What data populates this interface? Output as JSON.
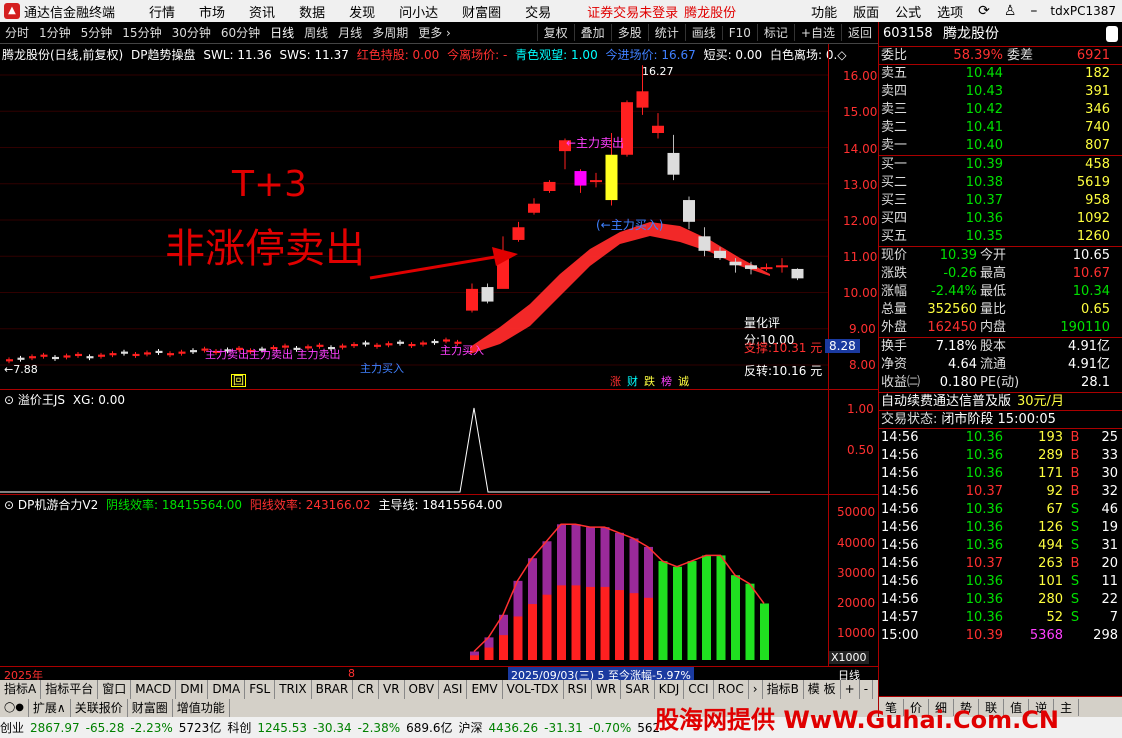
{
  "menubar": {
    "app_title": "通达信金融终端",
    "items": [
      "行情",
      "市场",
      "资讯",
      "数据",
      "发现",
      "问小达",
      "财富圈",
      "交易"
    ],
    "notice": "证券交易未登录",
    "notice_stock": "腾龙股份",
    "right_items": [
      "功能",
      "版面",
      "公式",
      "选项"
    ],
    "user": "tdxPC1387"
  },
  "periodbar": {
    "items": [
      "分时",
      "1分钟",
      "5分钟",
      "15分钟",
      "30分钟",
      "60分钟",
      "日线",
      "周线",
      "月线",
      "多周期",
      "更多 ›"
    ],
    "active": "日线",
    "tools": [
      "复权",
      "叠加",
      "多股",
      "统计",
      "画线",
      "F10",
      "标记",
      "+自选",
      "返回"
    ]
  },
  "main_chart": {
    "title": "腾龙股份(日线,前复权)",
    "indicator": "DP趋势操盘",
    "swl": "SWL: 11.36",
    "sws": "SWS: 11.37",
    "hold_label": "红色持股: 0.00",
    "leave_label": "今离场价: -",
    "watch_label": "青色观望: 1.00",
    "enter_label": "今进场价: 16.67",
    "short_label": "短买: 0.00",
    "white_label": "白色离场: 0.◇",
    "annotation_title": "T+3",
    "annotation_sub": "非涨停卖出",
    "labels": {
      "sell1": "←主力卖出",
      "buy1": "(←主力买入)",
      "high": "16.27",
      "low": "←7.88",
      "left_marks": "主力卖出主力卖出 主力卖出",
      "left_marks2": "主力买入",
      "left_marks3": "主力买入"
    },
    "quant_score": "量化评分:10.00",
    "support": "支撑:10.31 元",
    "reversal": "反转:10.16 元",
    "cur_price_tag": "8.28",
    "bottom_tags": [
      "涨",
      "财",
      "跌",
      "榜",
      "诚"
    ],
    "return_tag": "回",
    "y_ticks": [
      "16.00",
      "15.00",
      "14.00",
      "13.00",
      "12.00",
      "11.00",
      "10.00",
      "9.00",
      "8.00"
    ]
  },
  "chart_data": {
    "type": "candlestick",
    "ylim": [
      7.6,
      16.4
    ],
    "candles": [
      {
        "o": 9.5,
        "c": 10.1,
        "h": 10.25,
        "l": 9.45
      },
      {
        "o": 10.15,
        "c": 9.75,
        "h": 10.25,
        "l": 9.7
      },
      {
        "o": 10.1,
        "c": 11.1,
        "h": 11.55,
        "l": 10.7
      },
      {
        "o": 11.45,
        "c": 11.8,
        "h": 11.95,
        "l": 11.4
      },
      {
        "o": 12.2,
        "c": 12.45,
        "h": 12.6,
        "l": 12.15
      },
      {
        "o": 12.8,
        "c": 13.05,
        "h": 13.1,
        "l": 12.75
      },
      {
        "o": 13.9,
        "c": 14.2,
        "h": 14.25,
        "l": 13.4
      },
      {
        "o": 12.95,
        "c": 13.35,
        "h": 13.4,
        "l": 12.75
      },
      {
        "o": 13.1,
        "c": 13.1,
        "h": 13.3,
        "l": 12.9
      },
      {
        "o": 12.55,
        "c": 13.8,
        "h": 14.4,
        "l": 12.4
      },
      {
        "o": 13.8,
        "c": 15.25,
        "h": 15.3,
        "l": 13.75
      },
      {
        "o": 15.1,
        "c": 15.55,
        "h": 16.27,
        "l": 14.9
      },
      {
        "o": 14.4,
        "c": 14.6,
        "h": 14.95,
        "l": 14.25
      },
      {
        "o": 13.85,
        "c": 13.25,
        "h": 14.35,
        "l": 13.1
      },
      {
        "o": 12.55,
        "c": 11.95,
        "h": 12.65,
        "l": 11.75
      },
      {
        "o": 11.55,
        "c": 11.15,
        "h": 11.8,
        "l": 11.0
      },
      {
        "o": 11.15,
        "c": 10.95,
        "h": 11.25,
        "l": 10.9
      },
      {
        "o": 10.85,
        "c": 10.75,
        "h": 10.95,
        "l": 10.55
      },
      {
        "o": 10.75,
        "c": 10.65,
        "h": 10.85,
        "l": 10.5
      },
      {
        "o": 10.65,
        "c": 10.7,
        "h": 10.8,
        "l": 10.6
      },
      {
        "o": 10.75,
        "c": 10.75,
        "h": 10.95,
        "l": 10.55
      },
      {
        "o": 10.65,
        "c": 10.39,
        "h": 10.67,
        "l": 10.34
      }
    ]
  },
  "sub1": {
    "title": "溢价王JS",
    "xg": "XG: 0.00",
    "ticks": [
      "1.00",
      "0.50"
    ]
  },
  "sub2": {
    "title": "DP机游合力V2",
    "yin": "阴线效率: 18415564.00",
    "yang": "阳线效率: 243166.02",
    "main": "主导线: 18415564.00",
    "ticks": [
      "50000",
      "40000",
      "30000",
      "20000",
      "10000"
    ],
    "unit": "X1000"
  },
  "datebar": {
    "year": "2025年",
    "month": "8",
    "range": "2025/09/03(三) 5 至今涨幅-5.97%",
    "period": "日线"
  },
  "tabs": [
    "指标A",
    "指标平台",
    "窗口",
    "MACD",
    "DMI",
    "DMA",
    "FSL",
    "TRIX",
    "BRAR",
    "CR",
    "VR",
    "OBV",
    "ASI",
    "EMV",
    "VOL-TDX",
    "RSI",
    "WR",
    "SAR",
    "KDJ",
    "CCI",
    "ROC",
    "›",
    "指标B",
    "模 板",
    "+",
    "-"
  ],
  "tabs2": [
    "扩展∧",
    "关联报价",
    "财富圈",
    "增值功能"
  ],
  "status": [
    {
      "name": "创业",
      "v": "2867.97",
      "chg": "-65.28",
      "pct": "-2.23%",
      "amt": "5723亿"
    },
    {
      "name": "科创",
      "v": "1245.53",
      "chg": "-30.34",
      "pct": "-2.38%",
      "amt": "689.6亿"
    },
    {
      "name": "沪深",
      "v": "4436.26",
      "chg": "-31.31",
      "pct": "-0.70%",
      "amt": "562"
    }
  ],
  "watermark": "股海网提供 WwW.Guhai.Com.CN",
  "right": {
    "code": "603158",
    "name": "腾龙股份",
    "ratio_label": "委比",
    "ratio": "58.39%",
    "diff_label": "委差",
    "diff": "6921",
    "asks": [
      [
        "卖五",
        "10.44",
        "182"
      ],
      [
        "卖四",
        "10.43",
        "391"
      ],
      [
        "卖三",
        "10.42",
        "346"
      ],
      [
        "卖二",
        "10.41",
        "740"
      ],
      [
        "卖一",
        "10.40",
        "807"
      ]
    ],
    "bids": [
      [
        "买一",
        "10.39",
        "458"
      ],
      [
        "买二",
        "10.38",
        "5619"
      ],
      [
        "买三",
        "10.37",
        "958"
      ],
      [
        "买四",
        "10.36",
        "1092"
      ],
      [
        "买五",
        "10.35",
        "1260"
      ]
    ],
    "quote": [
      [
        "现价",
        "10.39",
        "今开",
        "10.65"
      ],
      [
        "涨跌",
        "-0.26",
        "最高",
        "10.67"
      ],
      [
        "涨幅",
        "-2.44%",
        "最低",
        "10.34"
      ],
      [
        "总量",
        "352560",
        "量比",
        "0.65"
      ],
      [
        "外盘",
        "162450",
        "内盘",
        "190110"
      ]
    ],
    "quote2": [
      [
        "换手",
        "7.18%",
        "股本",
        "4.91亿"
      ],
      [
        "净资",
        "4.64",
        "流通",
        "4.91亿"
      ],
      [
        "收益㈡",
        "0.180",
        "PE(动)",
        "28.1"
      ]
    ],
    "ad": "自动续费通达信普及版",
    "ad_price": "30元/月",
    "trade_state_label": "交易状态:",
    "trade_state": "闭市阶段 15:00:05",
    "ticks": [
      [
        "14:56",
        "10.36",
        "193",
        "B",
        "25"
      ],
      [
        "14:56",
        "10.36",
        "289",
        "B",
        "33"
      ],
      [
        "14:56",
        "10.36",
        "171",
        "B",
        "30"
      ],
      [
        "14:56",
        "10.37",
        "92",
        "B",
        "32"
      ],
      [
        "14:56",
        "10.36",
        "67",
        "S",
        "46"
      ],
      [
        "14:56",
        "10.36",
        "126",
        "S",
        "19"
      ],
      [
        "14:56",
        "10.36",
        "494",
        "S",
        "31"
      ],
      [
        "14:56",
        "10.37",
        "263",
        "B",
        "20"
      ],
      [
        "14:56",
        "10.36",
        "101",
        "S",
        "11"
      ],
      [
        "14:56",
        "10.36",
        "280",
        "S",
        "22"
      ],
      [
        "14:57",
        "10.36",
        "52",
        "S",
        "7"
      ],
      [
        "15:00",
        "10.39",
        "5368",
        "",
        "298"
      ]
    ],
    "bottom_tabs": [
      "笔",
      "价",
      "细",
      "势",
      "联",
      "值",
      "逆",
      "主"
    ]
  }
}
